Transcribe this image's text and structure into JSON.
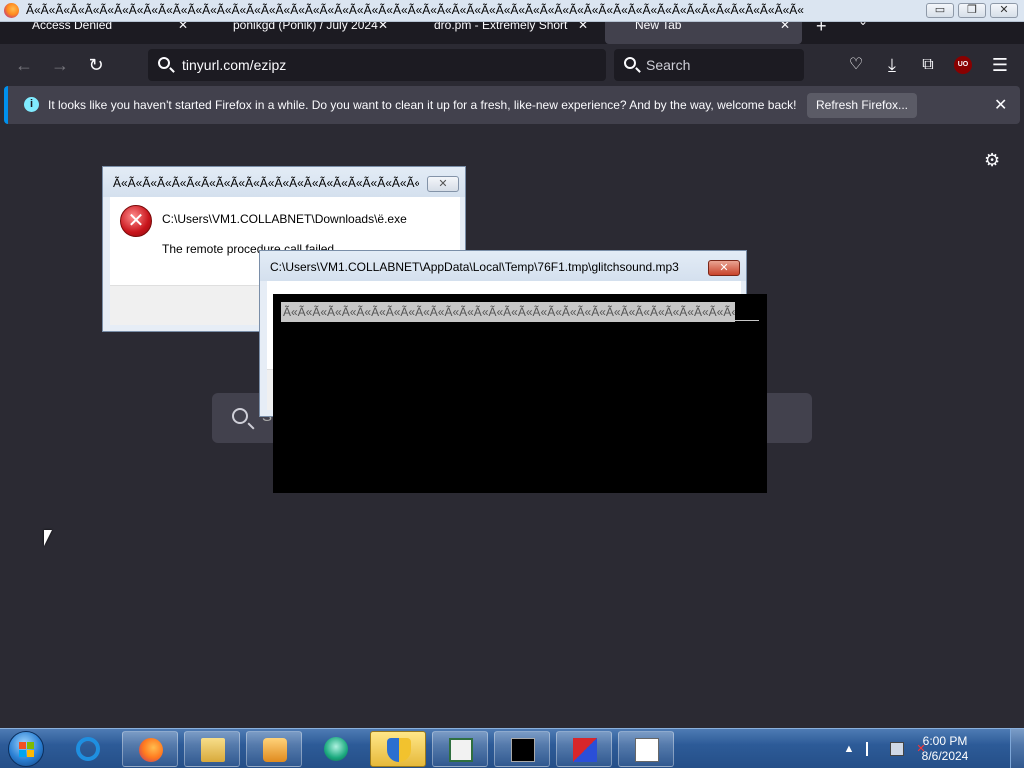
{
  "window": {
    "title": "Ã«Ã«Ã«Ã«Ã«Ã«Ã«Ã«Ã«Ã«Ã«Ã«Ã«Ã«Ã«Ã«Ã«Ã«Ã«Ã«Ã«Ã«Ã«Ã«Ã«Ã«Ã«Ã«Ã«Ã«Ã«Ã«Ã«Ã«Ã«Ã«Ã«Ã«Ã«Ã«Ã«Ã«Ã«Ã«Ã«Ã«Ã«Ã«Ã«Ã«Ã«Ã«Ã«",
    "minimize": "▭",
    "restore": "❐",
    "close": "✕"
  },
  "tabs": [
    {
      "label": "Access Denied",
      "close": "✕"
    },
    {
      "label": "ponikgd (Ponik) / July 2024",
      "close": "✕"
    },
    {
      "label": "dro.pm - Extremely Short U",
      "close": "✕"
    },
    {
      "label": "New Tab",
      "close": "✕"
    }
  ],
  "tabstrip": {
    "new_tab": "+",
    "list_all": "⌄"
  },
  "nav": {
    "back": "←",
    "forward": "→",
    "reload": "↻",
    "url": "tinyurl.com/ezipz",
    "search_placeholder": "Search",
    "pocket": "♡",
    "downloads": "⤓",
    "extensions": "⧉",
    "ublock": "UO",
    "menu": "☰"
  },
  "notification": {
    "icon": "i",
    "message": "It looks like you haven't started Firefox in a while. Do you want to clean it up for a fresh, like-new experience? And by the way, welcome back!",
    "button": "Refresh Firefox...",
    "close": "✕"
  },
  "newtab": {
    "settings": "⚙",
    "search_hint": "S"
  },
  "dialog1": {
    "title": "Ã«Ã«Ã«Ã«Ã«Ã«Ã«Ã«Ã«Ã«Ã«Ã«Ã«Ã«Ã«Ã«Ã«Ã«Ã«Ã«Ã«Ã«Ã«Ã«...",
    "close": "✕",
    "path": "C:\\Users\\VM1.COLLABNET\\Downloads\\ë.exe",
    "message": "The remote procedure call failed.",
    "error_icon": "✕"
  },
  "dialog2": {
    "title": "C:\\Users\\VM1.COLLABNET\\AppData\\Local\\Temp\\76F1.tmp\\glitchsound.mp3",
    "close": "✕"
  },
  "blackwindow": {
    "selected_text": "Ã«Ã«Ã«Ã«Ã«Ã«Ã«Ã«Ã«Ã«Ã«Ã«Ã«Ã«Ã«Ã«Ã«Ã«Ã«Ã«Ã«Ã«Ã«Ã«Ã«Ã«Ã«Ã«Ã«Ã«Ã«Ã«Ã«Ã«Ã«Ã«Ã«Ã«Ã«..."
  },
  "taskbar": {
    "clock_time": "6:00 PM",
    "clock_date": "8/6/2024",
    "tray_up": "▲"
  },
  "colors": {
    "firefox_bg": "#2b2a33",
    "firefox_dark": "#1c1b22",
    "accent_blue": "#0090ed",
    "error_red": "#c8141b"
  }
}
